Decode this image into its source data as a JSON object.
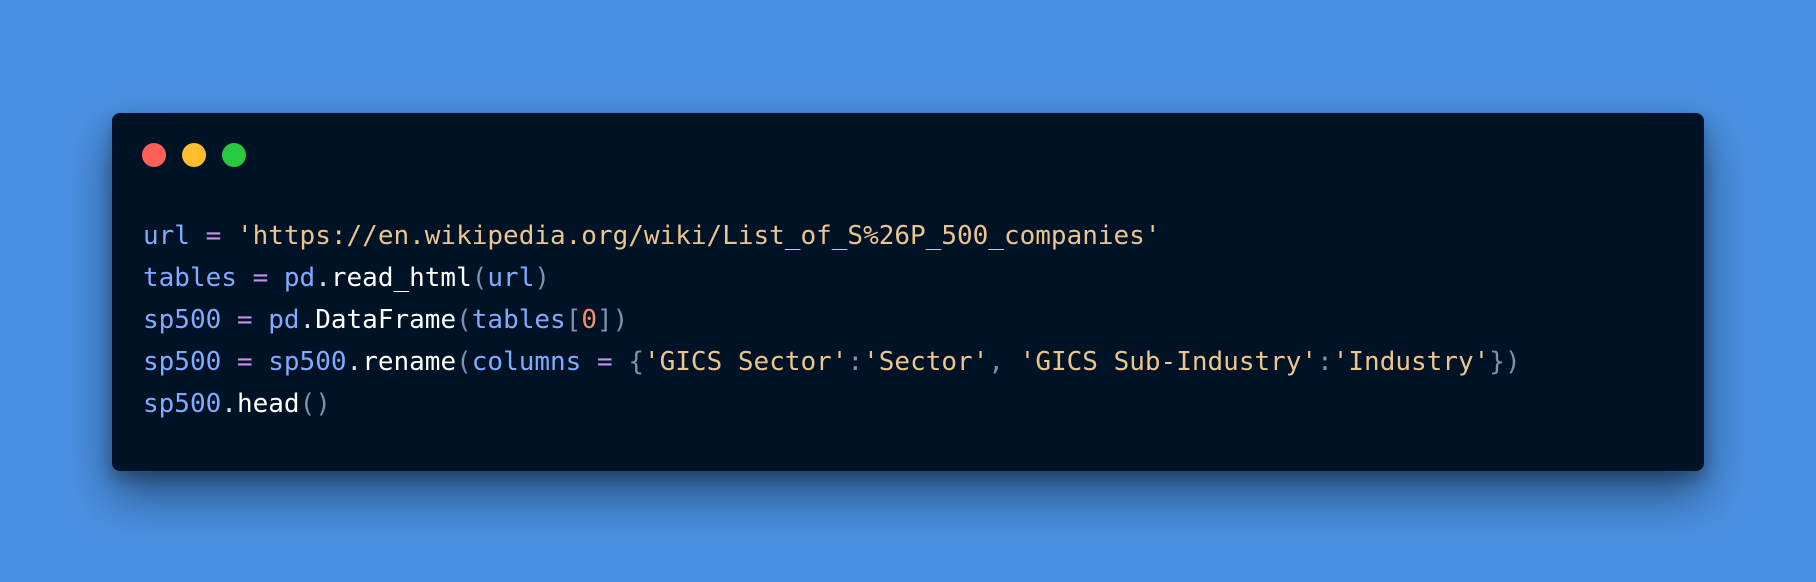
{
  "window": {
    "controls": [
      {
        "name": "close",
        "color": "#ff5f56"
      },
      {
        "name": "minimize",
        "color": "#ffbd2e"
      },
      {
        "name": "zoom",
        "color": "#27c93f"
      }
    ]
  },
  "code": {
    "language": "python",
    "lines": [
      [
        {
          "text": "url",
          "role": "var"
        },
        {
          "text": " ",
          "role": "txt"
        },
        {
          "text": "=",
          "role": "op"
        },
        {
          "text": " ",
          "role": "txt"
        },
        {
          "text": "'https://en.wikipedia.org/wiki/List_of_S%26P_500_companies'",
          "role": "str"
        }
      ],
      [
        {
          "text": "tables",
          "role": "var"
        },
        {
          "text": " ",
          "role": "txt"
        },
        {
          "text": "=",
          "role": "op"
        },
        {
          "text": " ",
          "role": "txt"
        },
        {
          "text": "pd",
          "role": "var"
        },
        {
          "text": ".",
          "role": "txt"
        },
        {
          "text": "read_html",
          "role": "fn"
        },
        {
          "text": "(",
          "role": "punc"
        },
        {
          "text": "url",
          "role": "var"
        },
        {
          "text": ")",
          "role": "punc"
        }
      ],
      [
        {
          "text": "sp500",
          "role": "var"
        },
        {
          "text": " ",
          "role": "txt"
        },
        {
          "text": "=",
          "role": "op"
        },
        {
          "text": " ",
          "role": "txt"
        },
        {
          "text": "pd",
          "role": "var"
        },
        {
          "text": ".",
          "role": "txt"
        },
        {
          "text": "DataFrame",
          "role": "fn"
        },
        {
          "text": "(",
          "role": "punc"
        },
        {
          "text": "tables",
          "role": "var"
        },
        {
          "text": "[",
          "role": "punc"
        },
        {
          "text": "0",
          "role": "num"
        },
        {
          "text": "])",
          "role": "punc"
        }
      ],
      [
        {
          "text": "sp500",
          "role": "var"
        },
        {
          "text": " ",
          "role": "txt"
        },
        {
          "text": "=",
          "role": "op"
        },
        {
          "text": " ",
          "role": "txt"
        },
        {
          "text": "sp500",
          "role": "var"
        },
        {
          "text": ".",
          "role": "txt"
        },
        {
          "text": "rename",
          "role": "fn"
        },
        {
          "text": "(",
          "role": "punc"
        },
        {
          "text": "columns",
          "role": "var"
        },
        {
          "text": " ",
          "role": "txt"
        },
        {
          "text": "=",
          "role": "op"
        },
        {
          "text": " ",
          "role": "txt"
        },
        {
          "text": "{",
          "role": "punc"
        },
        {
          "text": "'GICS Sector'",
          "role": "str"
        },
        {
          "text": ":",
          "role": "punc"
        },
        {
          "text": "'Sector'",
          "role": "str"
        },
        {
          "text": ",",
          "role": "punc"
        },
        {
          "text": " ",
          "role": "txt"
        },
        {
          "text": "'GICS Sub-Industry'",
          "role": "str"
        },
        {
          "text": ":",
          "role": "punc"
        },
        {
          "text": "'Industry'",
          "role": "str"
        },
        {
          "text": "})",
          "role": "punc"
        }
      ],
      [
        {
          "text": "sp500",
          "role": "var"
        },
        {
          "text": ".",
          "role": "txt"
        },
        {
          "text": "head",
          "role": "fn"
        },
        {
          "text": "()",
          "role": "punc"
        }
      ]
    ]
  },
  "colors": {
    "background": "#4a90e2",
    "window": "#001326",
    "var": "#82aaff",
    "op": "#c792ea",
    "str": "#ecc48d",
    "num": "#f78c6c",
    "fn": "#ffffff",
    "punc": "#7f91ab"
  }
}
